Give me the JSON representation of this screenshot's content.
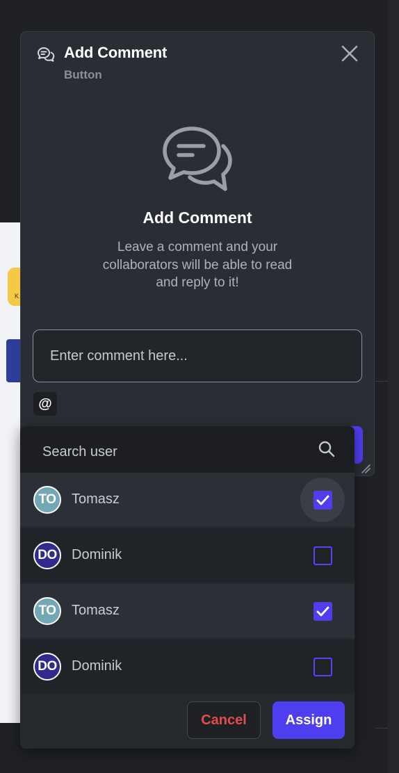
{
  "modal": {
    "title": "Add Comment",
    "subtitle": "Button",
    "empty_state": {
      "title": "Add Comment",
      "description": "Leave a comment and your collaborators will be able to read and reply to it!"
    },
    "comment_input": {
      "placeholder": "Enter comment here...",
      "value": ""
    },
    "mention_label": "@"
  },
  "user_picker": {
    "search": {
      "placeholder": "Search user",
      "value": ""
    },
    "users": [
      {
        "initials": "TO",
        "name": "Tomasz",
        "checked": true,
        "avatar_color": "#72a7b4"
      },
      {
        "initials": "DO",
        "name": "Dominik",
        "checked": false,
        "avatar_color": "#2e2a8e"
      },
      {
        "initials": "TO",
        "name": "Tomasz",
        "checked": true,
        "avatar_color": "#72a7b4"
      },
      {
        "initials": "DO",
        "name": "Dominik",
        "checked": false,
        "avatar_color": "#2e2a8e"
      }
    ],
    "cancel_label": "Cancel",
    "assign_label": "Assign"
  },
  "background": {
    "card_letter": "K"
  },
  "colors": {
    "accent": "#4f3ef0",
    "danger": "#e04e4e",
    "surface": "#2a2d33"
  },
  "icons": [
    "comment-icon",
    "close-icon",
    "comment-bubbles-icon",
    "at-icon",
    "search-icon",
    "checkmark-icon",
    "resize-handle-icon"
  ]
}
